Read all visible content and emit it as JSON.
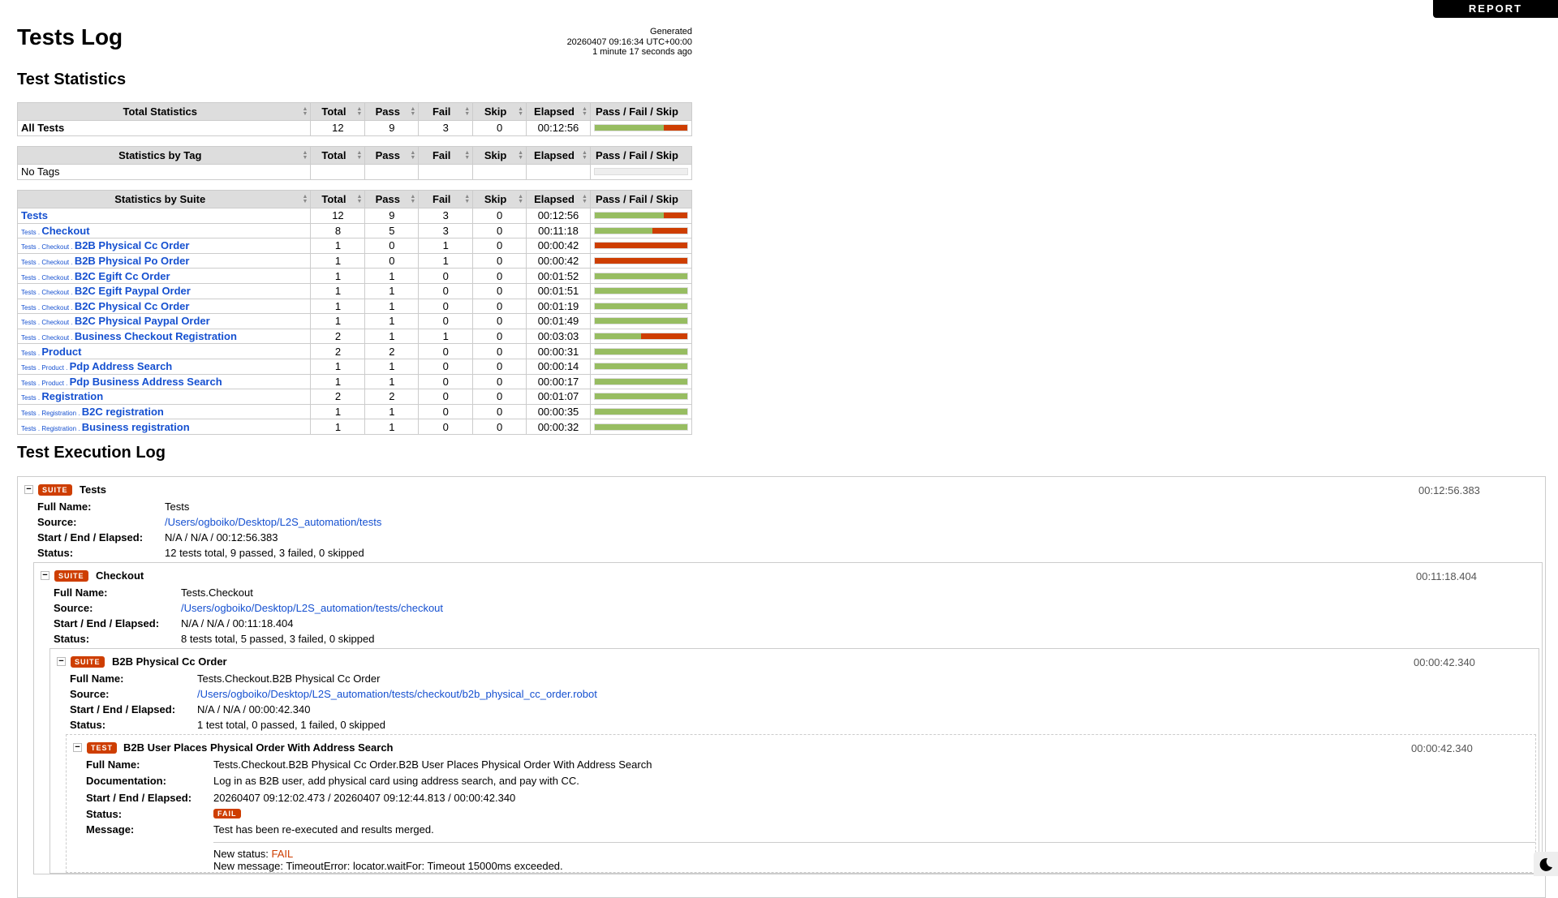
{
  "header": {
    "report_button": "REPORT",
    "title": "Tests Log",
    "generated_label": "Generated",
    "generated_time": "20260407 09:16:34 UTC+00:00",
    "generated_ago": "1 minute 17 seconds ago"
  },
  "statistics": {
    "title": "Test Statistics",
    "columns": [
      "Total",
      "Pass",
      "Fail",
      "Skip",
      "Elapsed",
      "Pass / Fail / Skip"
    ],
    "total": {
      "header": "Total Statistics",
      "rows": [
        {
          "name": "All Tests",
          "total": 12,
          "pass": 9,
          "fail": 3,
          "skip": 0,
          "elapsed": "00:12:56"
        }
      ]
    },
    "tag": {
      "header": "Statistics by Tag",
      "rows": [
        {
          "name": "No Tags",
          "total": "",
          "pass": "",
          "fail": "",
          "skip": "",
          "elapsed": ""
        }
      ]
    },
    "suite": {
      "header": "Statistics by Suite",
      "rows": [
        {
          "prefix": "",
          "name": "Tests",
          "total": 12,
          "pass": 9,
          "fail": 3,
          "skip": 0,
          "elapsed": "00:12:56"
        },
        {
          "prefix": "Tests . ",
          "name": "Checkout",
          "total": 8,
          "pass": 5,
          "fail": 3,
          "skip": 0,
          "elapsed": "00:11:18"
        },
        {
          "prefix": "Tests . Checkout . ",
          "name": "B2B Physical Cc Order",
          "total": 1,
          "pass": 0,
          "fail": 1,
          "skip": 0,
          "elapsed": "00:00:42"
        },
        {
          "prefix": "Tests . Checkout . ",
          "name": "B2B Physical Po Order",
          "total": 1,
          "pass": 0,
          "fail": 1,
          "skip": 0,
          "elapsed": "00:00:42"
        },
        {
          "prefix": "Tests . Checkout . ",
          "name": "B2C Egift Cc Order",
          "total": 1,
          "pass": 1,
          "fail": 0,
          "skip": 0,
          "elapsed": "00:01:52"
        },
        {
          "prefix": "Tests . Checkout . ",
          "name": "B2C Egift Paypal Order",
          "total": 1,
          "pass": 1,
          "fail": 0,
          "skip": 0,
          "elapsed": "00:01:51"
        },
        {
          "prefix": "Tests . Checkout . ",
          "name": "B2C Physical Cc Order",
          "total": 1,
          "pass": 1,
          "fail": 0,
          "skip": 0,
          "elapsed": "00:01:19"
        },
        {
          "prefix": "Tests . Checkout . ",
          "name": "B2C Physical Paypal Order",
          "total": 1,
          "pass": 1,
          "fail": 0,
          "skip": 0,
          "elapsed": "00:01:49"
        },
        {
          "prefix": "Tests . Checkout . ",
          "name": "Business Checkout Registration",
          "total": 2,
          "pass": 1,
          "fail": 1,
          "skip": 0,
          "elapsed": "00:03:03"
        },
        {
          "prefix": "Tests . ",
          "name": "Product",
          "total": 2,
          "pass": 2,
          "fail": 0,
          "skip": 0,
          "elapsed": "00:00:31"
        },
        {
          "prefix": "Tests . Product . ",
          "name": "Pdp Address Search",
          "total": 1,
          "pass": 1,
          "fail": 0,
          "skip": 0,
          "elapsed": "00:00:14"
        },
        {
          "prefix": "Tests . Product . ",
          "name": "Pdp Business Address Search",
          "total": 1,
          "pass": 1,
          "fail": 0,
          "skip": 0,
          "elapsed": "00:00:17"
        },
        {
          "prefix": "Tests . ",
          "name": "Registration",
          "total": 2,
          "pass": 2,
          "fail": 0,
          "skip": 0,
          "elapsed": "00:01:07"
        },
        {
          "prefix": "Tests . Registration . ",
          "name": "B2C registration",
          "total": 1,
          "pass": 1,
          "fail": 0,
          "skip": 0,
          "elapsed": "00:00:35"
        },
        {
          "prefix": "Tests . Registration . ",
          "name": "Business registration",
          "total": 1,
          "pass": 1,
          "fail": 0,
          "skip": 0,
          "elapsed": "00:00:32"
        }
      ]
    }
  },
  "log": {
    "title": "Test Execution Log",
    "labels": {
      "full_name": "Full Name:",
      "source": "Source:",
      "times": "Start / End / Elapsed:",
      "status": "Status:",
      "documentation": "Documentation:",
      "message": "Message:"
    },
    "suite_badge": "SUITE",
    "test_badge": "TEST",
    "toggle": "−",
    "tests": {
      "name": "Tests",
      "elapsed": "00:12:56.383",
      "full_name": "Tests",
      "source": "/Users/ogboiko/Desktop/L2S_automation/tests",
      "times": "N/A / N/A / 00:12:56.383",
      "status": "12 tests total, 9 passed, 3 failed, 0 skipped"
    },
    "checkout": {
      "name": "Checkout",
      "elapsed": "00:11:18.404",
      "full_name": "Tests.Checkout",
      "source": "/Users/ogboiko/Desktop/L2S_automation/tests/checkout",
      "times": "N/A / N/A / 00:11:18.404",
      "status": "8 tests total, 5 passed, 3 failed, 0 skipped"
    },
    "b2b": {
      "name": "B2B Physical Cc Order",
      "elapsed": "00:00:42.340",
      "full_name": "Tests.Checkout.B2B Physical Cc Order",
      "source": "/Users/ogboiko/Desktop/L2S_automation/tests/checkout/b2b_physical_cc_order.robot",
      "times": "N/A / N/A / 00:00:42.340",
      "status": "1 test total, 0 passed, 1 failed, 0 skipped"
    },
    "test": {
      "name": "B2B User Places Physical Order With Address Search",
      "elapsed": "00:00:42.340",
      "full_name": "Tests.Checkout.B2B Physical Cc Order.B2B User Places Physical Order With Address Search",
      "documentation": "Log in as B2B user, add physical card using address search, and pay with CC.",
      "times": "20260407 09:12:02.473 / 20260407 09:12:44.813 / 00:00:42.340",
      "status": "FAIL",
      "message": "Test has been re-executed and results merged.",
      "new_status_label": "New status: ",
      "new_status": "FAIL",
      "new_message": "New message: TimeoutError: locator.waitFor: Timeout 15000ms exceeded."
    }
  },
  "colors": {
    "pass": "#97bd61",
    "fail": "#ce3e01",
    "skip": "#fed84f"
  }
}
